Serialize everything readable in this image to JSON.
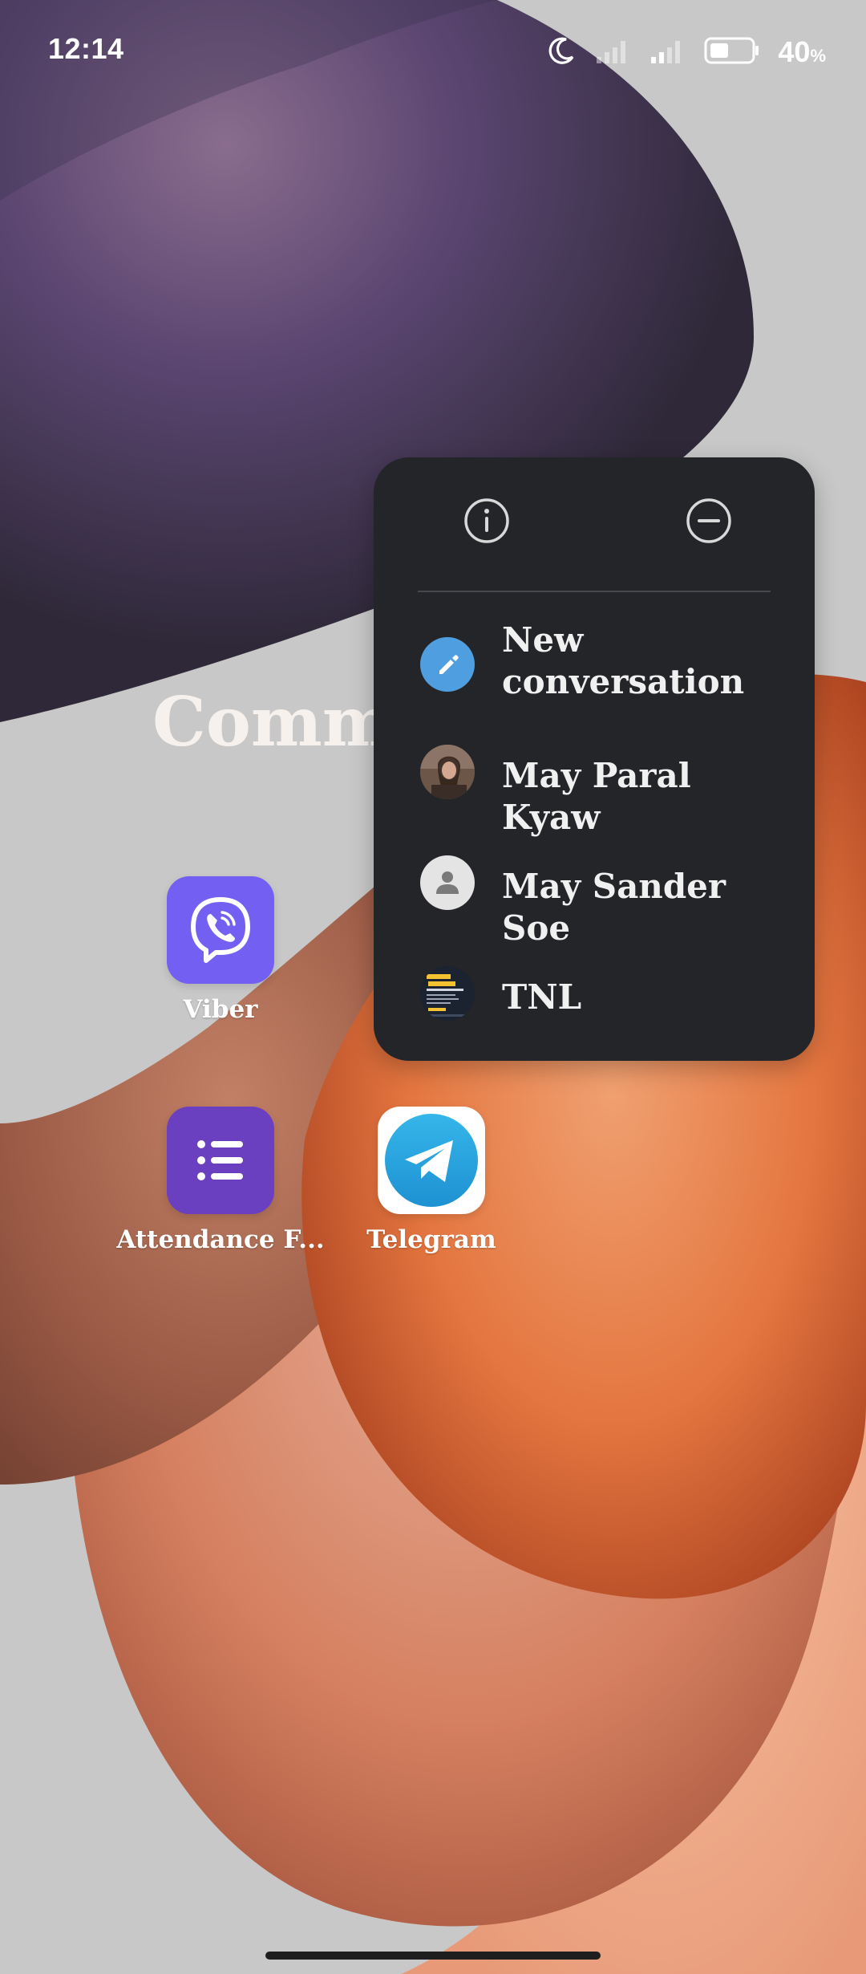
{
  "status_bar": {
    "time": "12:14",
    "battery_percent": "40",
    "battery_unit": "%",
    "icons": [
      "moon-icon",
      "signal-icon",
      "signal-icon",
      "battery-icon"
    ]
  },
  "folder": {
    "title": "Comm"
  },
  "apps": [
    {
      "label": "Viber",
      "icon": "viber-icon",
      "color": "#7360f2"
    },
    {
      "label": "Attendance F...",
      "icon": "list-icon",
      "color": "#6a3fc0"
    },
    {
      "label": "Telegram",
      "icon": "telegram-icon",
      "color": "#2aa3e0"
    }
  ],
  "context_menu": {
    "actions": [
      {
        "icon": "info-icon"
      },
      {
        "icon": "remove-icon"
      }
    ],
    "shortcuts": [
      {
        "label": "New conversation",
        "icon": "pencil-icon",
        "color": "#4f9ee0"
      },
      {
        "label": "May Paral Kyaw",
        "icon": "avatar-photo"
      },
      {
        "label": "May Sander Soe",
        "icon": "person-icon"
      },
      {
        "label": "TNL",
        "icon": "avatar-thumbnail"
      }
    ]
  }
}
